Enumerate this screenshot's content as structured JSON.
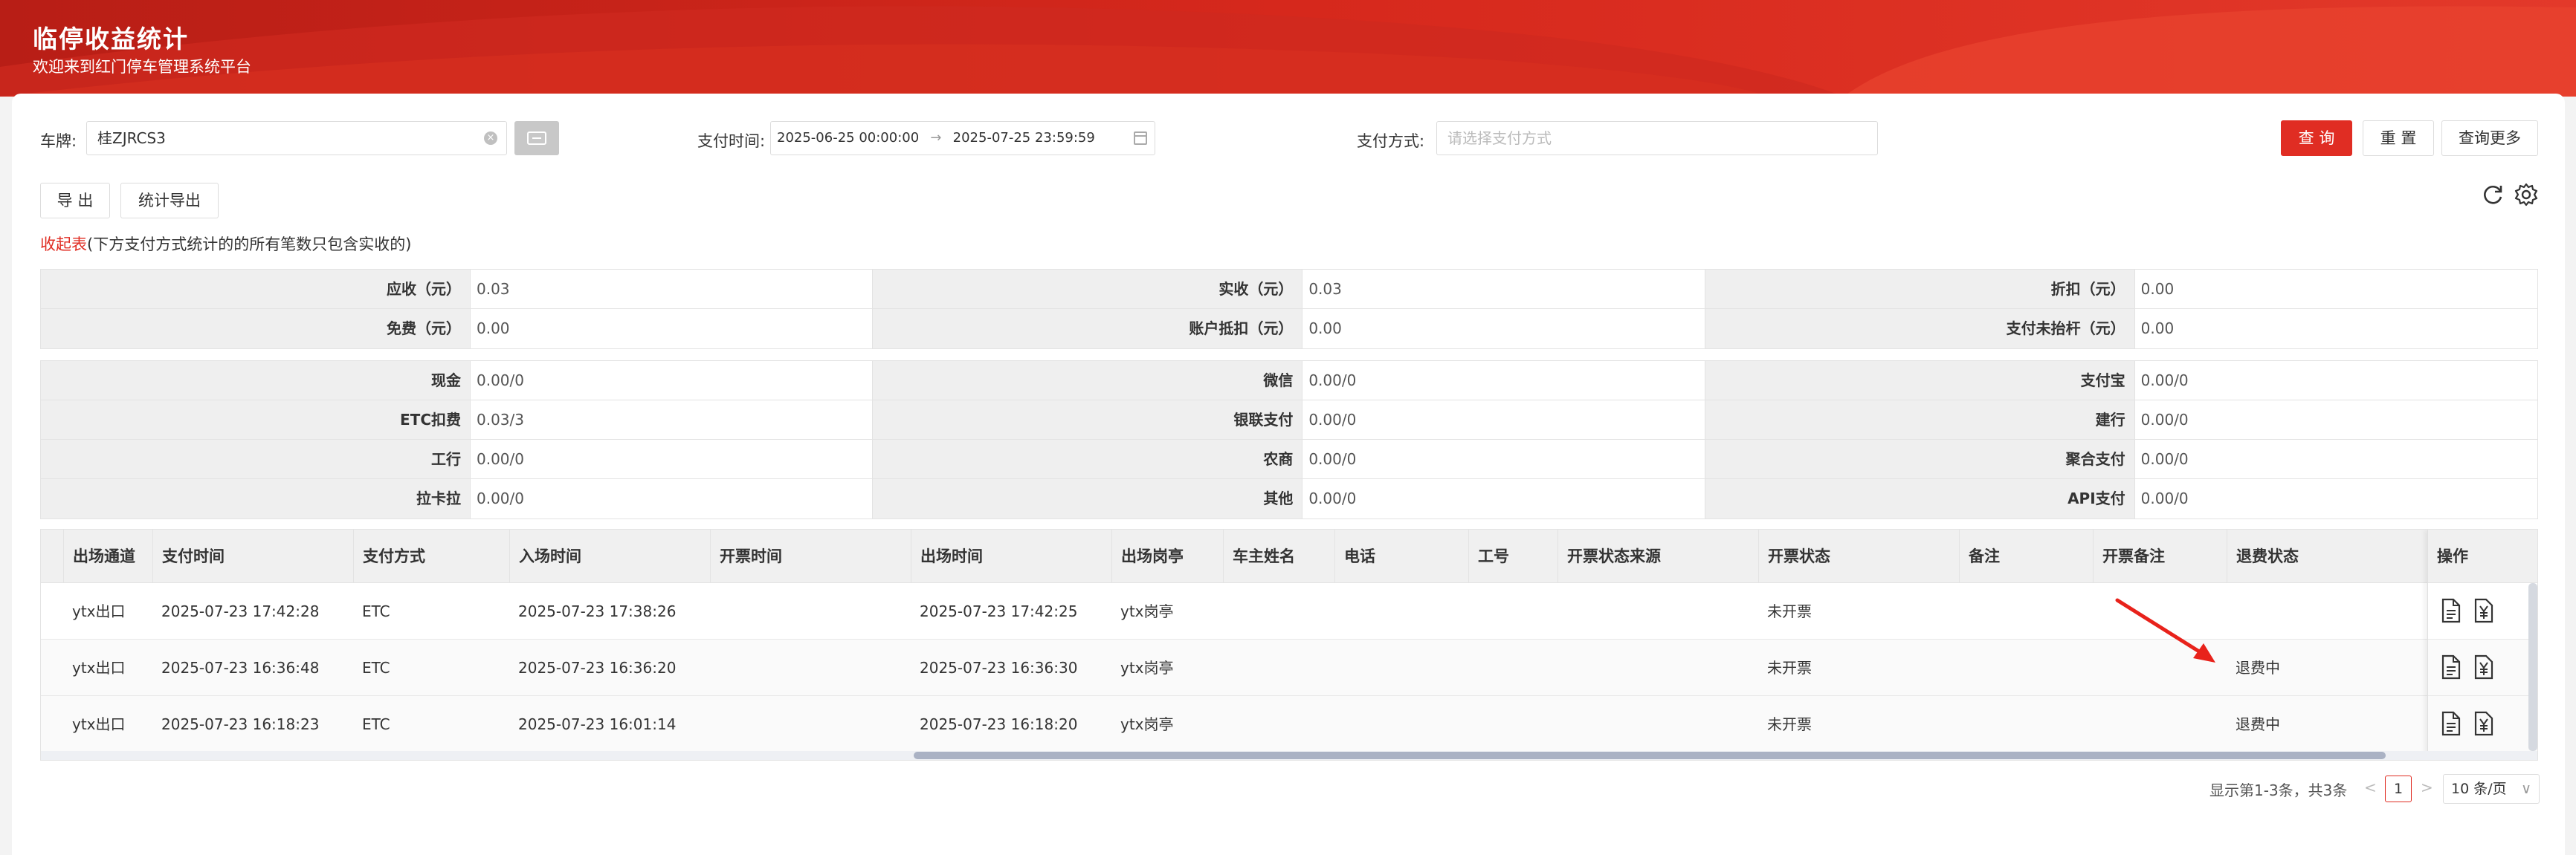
{
  "header": {
    "title": "临停收益统计",
    "subtitle": "欢迎来到红门停车管理系统平台"
  },
  "filters": {
    "plate_label": "车牌:",
    "plate_value": "桂ZJRCS3",
    "pay_time_label": "支付时间:",
    "start_time": "2025-06-25 00:00:00",
    "end_time": "2025-07-25 23:59:59",
    "date_separator": "→",
    "pay_method_label": "支付方式:",
    "pay_method_placeholder": "请选择支付方式",
    "query_label": "查 询",
    "reset_label": "重 置",
    "more_label": "查询更多"
  },
  "toolbar": {
    "export_label": "导 出",
    "stat_export_label": "统计导出"
  },
  "note": {
    "red": "收起表",
    "text": "(下方支付方式统计的的所有笔数只包含实收的)"
  },
  "summary1": [
    [
      {
        "label": "应收（元）",
        "value": "0.03"
      },
      {
        "label": "实收（元）",
        "value": "0.03"
      },
      {
        "label": "折扣（元）",
        "value": "0.00"
      }
    ],
    [
      {
        "label": "免费（元）",
        "value": "0.00"
      },
      {
        "label": "账户抵扣（元）",
        "value": "0.00"
      },
      {
        "label": "支付未抬杆（元）",
        "value": "0.00"
      }
    ]
  ],
  "summary2": [
    [
      {
        "label": "现金",
        "value": "0.00/0"
      },
      {
        "label": "微信",
        "value": "0.00/0"
      },
      {
        "label": "支付宝",
        "value": "0.00/0"
      }
    ],
    [
      {
        "label": "ETC扣费",
        "value": "0.03/3"
      },
      {
        "label": "银联支付",
        "value": "0.00/0"
      },
      {
        "label": "建行",
        "value": "0.00/0"
      }
    ],
    [
      {
        "label": "工行",
        "value": "0.00/0"
      },
      {
        "label": "农商",
        "value": "0.00/0"
      },
      {
        "label": "聚合支付",
        "value": "0.00/0"
      }
    ],
    [
      {
        "label": "拉卡拉",
        "value": "0.00/0"
      },
      {
        "label": "其他",
        "value": "0.00/0"
      },
      {
        "label": "API支付",
        "value": "0.00/0"
      }
    ]
  ],
  "table": {
    "columns": [
      "出场通道",
      "支付时间",
      "支付方式",
      "入场时间",
      "开票时间",
      "出场时间",
      "出场岗亭",
      "车主姓名",
      "电话",
      "工号",
      "开票状态来源",
      "开票状态",
      "备注",
      "开票备注",
      "退费状态",
      "操作"
    ],
    "rows": [
      [
        "ytx出口",
        "2025-07-23 17:42:28",
        "ETC",
        "2025-07-23 17:38:26",
        "",
        "2025-07-23 17:42:25",
        "ytx岗亭",
        "",
        "",
        "",
        "",
        "未开票",
        "",
        "",
        ""
      ],
      [
        "ytx出口",
        "2025-07-23 16:36:48",
        "ETC",
        "2025-07-23 16:36:20",
        "",
        "2025-07-23 16:36:30",
        "ytx岗亭",
        "",
        "",
        "",
        "",
        "未开票",
        "",
        "",
        "退费中"
      ],
      [
        "ytx出口",
        "2025-07-23 16:18:23",
        "ETC",
        "2025-07-23 16:01:14",
        "",
        "2025-07-23 16:18:20",
        "ytx岗亭",
        "",
        "",
        "",
        "",
        "未开票",
        "",
        "",
        "退费中"
      ]
    ]
  },
  "pager": {
    "summary": "显示第1-3条，共3条",
    "prev": "<",
    "current": "1",
    "next": ">",
    "page_size": "10 条/页",
    "chevron": "∨"
  },
  "colors": {
    "brand": "#e02d23",
    "annotation_arrow": "#e8221b"
  }
}
